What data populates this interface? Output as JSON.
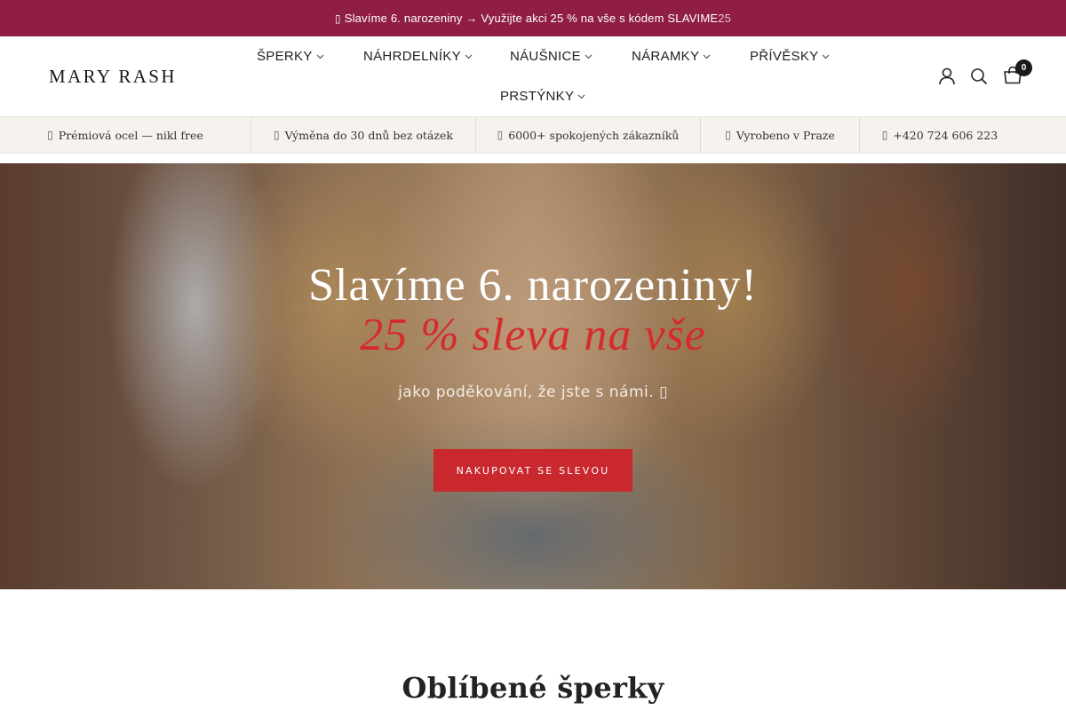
{
  "announcement": {
    "gift_icon": "gift-icon",
    "text": "Slavíme 6. narozeniny → Využijte akci 25 % na vše s kódem SLAVIME",
    "text_tail": "25",
    "bg_color": "#8f1d45"
  },
  "header": {
    "logo": "MARY RASH",
    "nav": [
      {
        "label": "ŠPERKY"
      },
      {
        "label": "NÁHRDELNÍKY"
      },
      {
        "label": "NÁUŠNICE"
      },
      {
        "label": "NÁRAMKY"
      },
      {
        "label": "PŘÍVĚSKY"
      },
      {
        "label": "PRSTÝNKY"
      }
    ],
    "icons": [
      "account-icon",
      "search-icon",
      "cart-icon"
    ],
    "cart_count": "0"
  },
  "usp_bar": {
    "items": [
      {
        "icon": "shield-icon",
        "text": "Prémiová ocel — nikl free"
      },
      {
        "icon": "return-icon",
        "text": "Výměna do 30 dnů bez otázek"
      },
      {
        "icon": "users-icon",
        "text": "6000+ spokojených zákazníků"
      },
      {
        "icon": "pin-icon",
        "text": "Vyrobeno v Praze"
      },
      {
        "icon": "phone-icon",
        "text": "+420 724 606 223"
      }
    ]
  },
  "hero": {
    "title": "Slavíme 6. narozeniny!",
    "subtitle": "25 % sleva na vše",
    "tagline": "jako poděkování, že jste s námi.",
    "tagline_icon": "heart-icon",
    "cta_label": "NAKUPOVAT SE SLEVOU",
    "accent_color": "#c8282e"
  },
  "section": {
    "title": "Oblíbené šperky"
  }
}
